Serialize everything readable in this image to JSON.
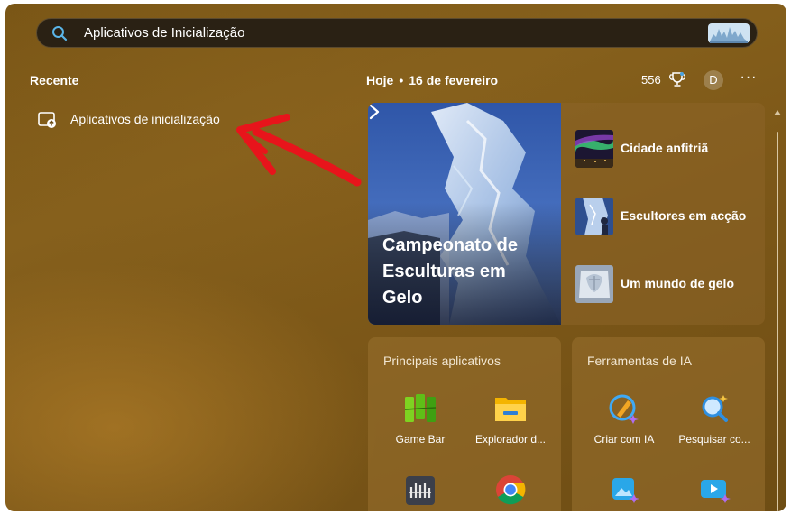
{
  "search": {
    "value": "Aplicativos de Inicialização",
    "icon": "search-icon"
  },
  "left": {
    "heading": "Recente",
    "recent_items": [
      {
        "label": "Aplicativos de inicialização",
        "icon": "startup-apps-icon"
      }
    ]
  },
  "header": {
    "today": "Hoje",
    "separator": "•",
    "date": "16 de fevereiro",
    "points": "556",
    "avatar_initial": "D",
    "more": "···"
  },
  "news": {
    "hero_title": "Campeonato de Esculturas em Gelo",
    "stories": [
      {
        "label": "Cidade anfitriã"
      },
      {
        "label": "Escultores em acção"
      },
      {
        "label": "Um mundo de gelo"
      }
    ]
  },
  "top_apps": {
    "title": "Principais aplicativos",
    "apps": [
      {
        "label": "Game Bar",
        "icon": "game-bar-icon"
      },
      {
        "label": "Explorador d...",
        "icon": "file-explorer-icon"
      },
      {
        "label": "",
        "icon": "media-app-icon"
      },
      {
        "label": "",
        "icon": "chrome-icon"
      }
    ]
  },
  "ai_tools": {
    "title": "Ferramentas de IA",
    "apps": [
      {
        "label": "Criar com IA",
        "icon": "create-with-ai-icon"
      },
      {
        "label": "Pesquisar co...",
        "icon": "search-with-ai-icon"
      },
      {
        "label": "",
        "icon": "image-ai-icon"
      },
      {
        "label": "",
        "icon": "video-ai-icon"
      }
    ]
  },
  "colors": {
    "accent_red_arrow": "#e8141b",
    "panel_brown": "#7d5818",
    "search_bg": "#2a2114"
  }
}
